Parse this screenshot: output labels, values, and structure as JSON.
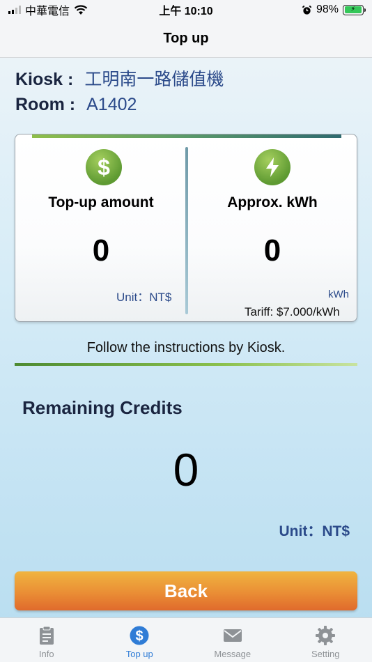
{
  "status_bar": {
    "carrier": "中華電信",
    "time": "上午 10:10",
    "battery_percent": "98%",
    "battery_level": 0.98
  },
  "nav": {
    "title": "Top up"
  },
  "info": {
    "kiosk_label": "Kiosk :",
    "kiosk_value": "工明南一路儲值機",
    "room_label": "Room :",
    "room_value": "A1402"
  },
  "card": {
    "left": {
      "icon": "dollar-icon",
      "label": "Top-up amount",
      "value": "0",
      "unit": "Unit：NT$"
    },
    "right": {
      "icon": "lightning-icon",
      "label": "Approx. kWh",
      "value": "0",
      "unit": "kWh",
      "tariff": "Tariff: $7.000/kWh"
    }
  },
  "instructions": "Follow the instructions by Kiosk.",
  "remaining": {
    "title": "Remaining Credits",
    "value": "0",
    "unit": "Unit：NT$"
  },
  "back_label": "Back",
  "tabs": [
    {
      "label": "Info",
      "icon": "clipboard-icon"
    },
    {
      "label": "Top up",
      "icon": "dollar-circle-icon"
    },
    {
      "label": "Message",
      "icon": "envelope-icon"
    },
    {
      "label": "Setting",
      "icon": "gear-icon"
    }
  ],
  "colors": {
    "accent_blue": "#2f7cd6",
    "text_blue": "#2b4a8a",
    "icon_green": "#6aa83a",
    "button_orange": "#ea8e35"
  }
}
